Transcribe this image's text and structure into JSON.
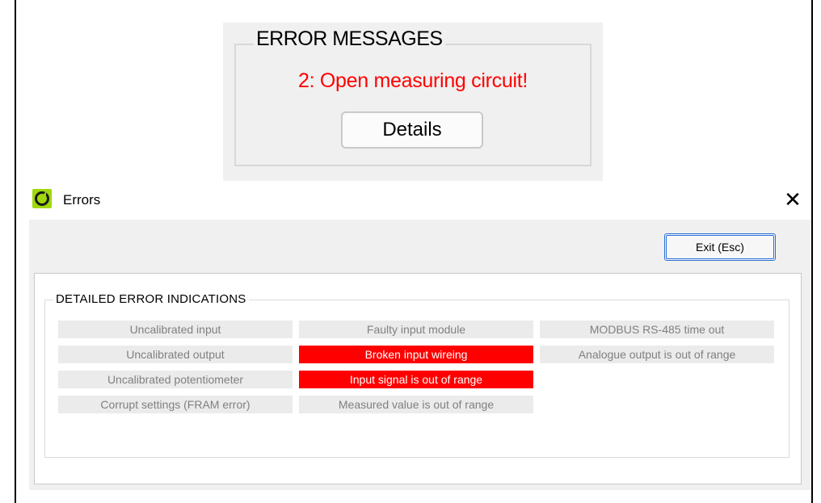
{
  "error_panel": {
    "group_title": "ERROR MESSAGES",
    "message": "2: Open measuring circuit!",
    "details_label": "Details"
  },
  "errors_window": {
    "title": "Errors",
    "close_glyph": "✕",
    "exit_label": "Exit (Esc)",
    "group_title": "DETAILED ERROR INDICATIONS",
    "indicators": [
      {
        "label": "Uncalibrated input",
        "active": false
      },
      {
        "label": "Uncalibrated output",
        "active": false
      },
      {
        "label": "Uncalibrated potentiometer",
        "active": false
      },
      {
        "label": "Corrupt settings (FRAM error)",
        "active": false
      },
      {
        "label": "Faulty input module",
        "active": false
      },
      {
        "label": "Broken input wireing",
        "active": true
      },
      {
        "label": "Input signal is out of range",
        "active": true
      },
      {
        "label": "Measured value is out of range",
        "active": false
      },
      {
        "label": "MODBUS RS-485 time out",
        "active": false
      },
      {
        "label": "Analogue output is out of range",
        "active": false
      }
    ]
  },
  "colors": {
    "error_text": "#ff0000",
    "active_indicator": "#ff0000",
    "inactive_indicator": "#ebebeb",
    "app_icon": "#a0d80a"
  },
  "icons": [
    "app-logo-icon",
    "close-icon"
  ]
}
